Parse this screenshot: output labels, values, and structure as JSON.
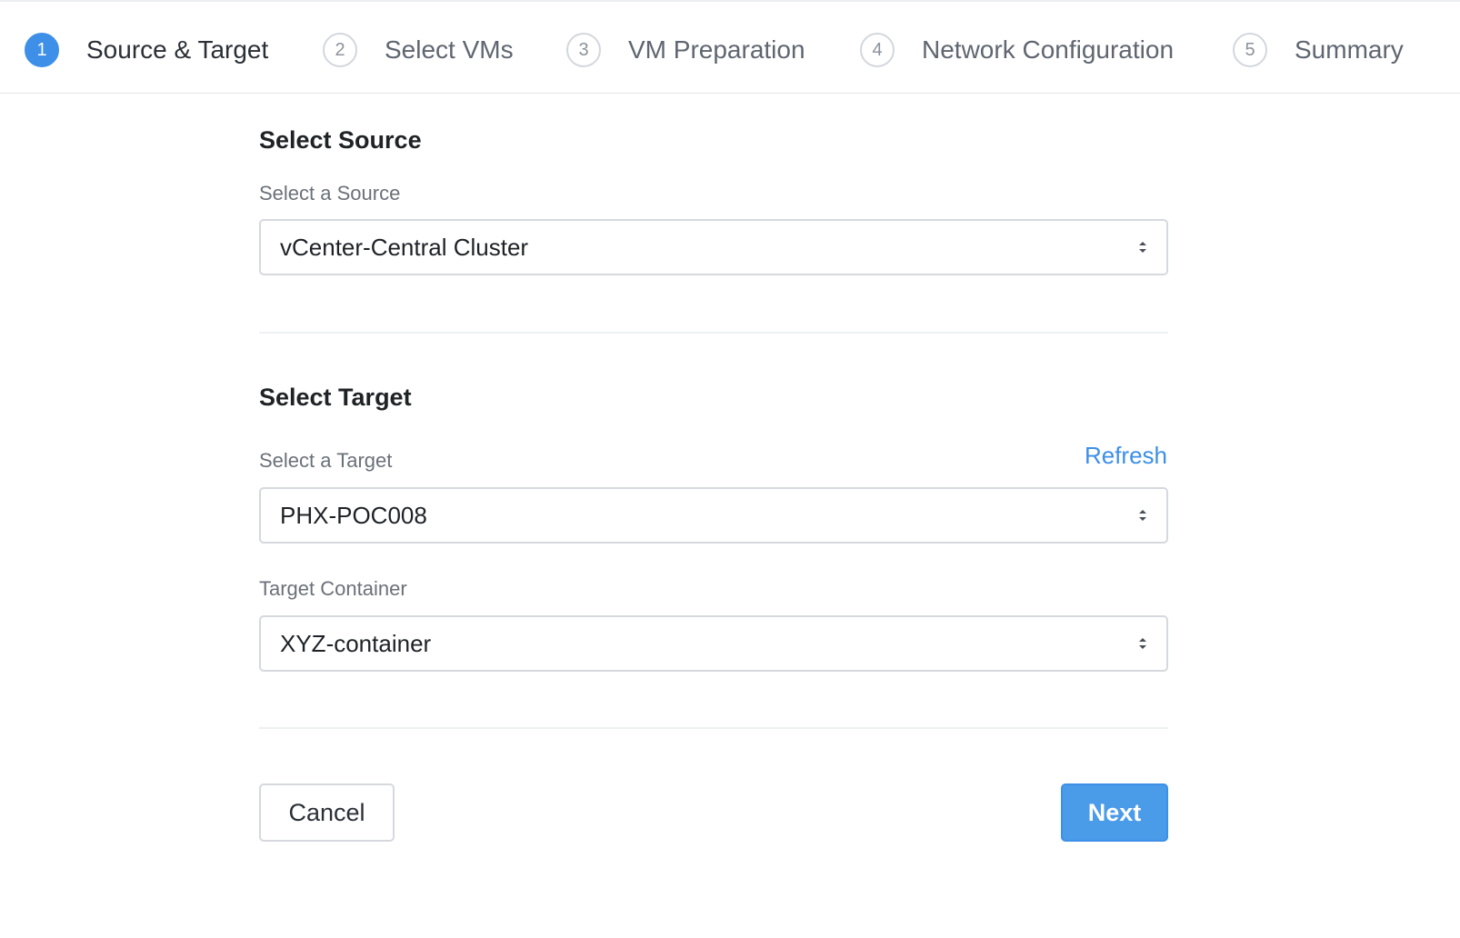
{
  "wizard": {
    "steps": [
      {
        "number": "1",
        "label": "Source & Target",
        "active": true
      },
      {
        "number": "2",
        "label": "Select VMs",
        "active": false
      },
      {
        "number": "3",
        "label": "VM Preparation",
        "active": false
      },
      {
        "number": "4",
        "label": "Network Configuration",
        "active": false
      },
      {
        "number": "5",
        "label": "Summary",
        "active": false
      }
    ]
  },
  "source": {
    "title": "Select Source",
    "label": "Select a Source",
    "value": "vCenter-Central Cluster"
  },
  "target": {
    "title": "Select Target",
    "label": "Select a Target",
    "refresh_label": "Refresh",
    "value": "PHX-POC008",
    "container_label": "Target Container",
    "container_value": "XYZ-container"
  },
  "footer": {
    "cancel_label": "Cancel",
    "next_label": "Next"
  },
  "colors": {
    "accent": "#3d8fe8",
    "border": "#d5d8dd"
  }
}
